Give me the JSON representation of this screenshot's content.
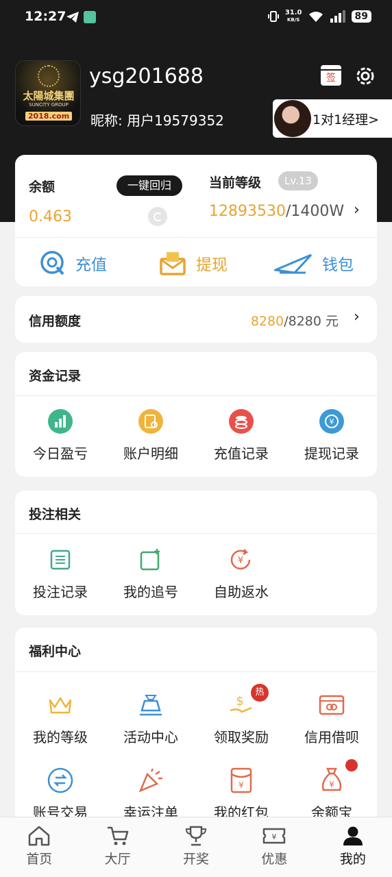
{
  "status_bar": {
    "time": "12:27",
    "net_speed": "31.0",
    "net_unit": "KB/S",
    "battery": "89"
  },
  "profile": {
    "logo_text": "太陽城集團",
    "logo_sub": "SUNCITY GROUP",
    "logo_domain": "2018.com",
    "username": "ysg201688",
    "nickname": "昵称: 用户19579352",
    "sign_label": "签",
    "manager_label": "1对1经理>"
  },
  "balance_card": {
    "balance_label": "余额",
    "recall_button": "一键回归",
    "balance_value": "0.463",
    "level_label": "当前等级",
    "level_badge": "Lv.13",
    "exp_current": "12893530",
    "exp_max": "/1400W",
    "actions": [
      {
        "label": "充值",
        "icon": "recharge-icon",
        "color": "#3d8fd6"
      },
      {
        "label": "提现",
        "icon": "withdraw-icon",
        "color": "#e7a431"
      },
      {
        "label": "钱包",
        "icon": "wallet-icon",
        "color": "#3d8fd6"
      }
    ]
  },
  "credit": {
    "label": "信用额度",
    "available": "8280",
    "total": "/8280 元"
  },
  "funds": {
    "title": "资金记录",
    "items": [
      {
        "label": "今日盈亏",
        "icon": "chart-icon",
        "color": "#3fb58a"
      },
      {
        "label": "账户明细",
        "icon": "detail-icon",
        "color": "#f0b43c"
      },
      {
        "label": "充值记录",
        "icon": "coins-icon",
        "color": "#e8504a"
      },
      {
        "label": "提现记录",
        "icon": "exchange-icon",
        "color": "#3d9ad6"
      }
    ]
  },
  "bets": {
    "title": "投注相关",
    "items": [
      {
        "label": "投注记录",
        "icon": "list-icon",
        "color": "#3fa88f"
      },
      {
        "label": "我的追号",
        "icon": "add-square-icon",
        "color": "#3fa870"
      },
      {
        "label": "自助返水",
        "icon": "rebate-icon",
        "color": "#e06a4a"
      }
    ]
  },
  "welfare": {
    "title": "福利中心",
    "items": [
      {
        "label": "我的等级",
        "icon": "crown-icon",
        "color": "#f0b43c"
      },
      {
        "label": "活动中心",
        "icon": "gift-icon",
        "color": "#3d8fd6"
      },
      {
        "label": "领取奖励",
        "icon": "reward-icon",
        "color": "#f0b43c",
        "badge": "热"
      },
      {
        "label": "信用借呗",
        "icon": "card-icon",
        "color": "#e06a4a"
      },
      {
        "label": "账号交易",
        "icon": "swap-icon",
        "color": "#3d8fd6"
      },
      {
        "label": "幸运注单",
        "icon": "party-icon",
        "color": "#e06a4a"
      },
      {
        "label": "我的红包",
        "icon": "red-envelope-icon",
        "color": "#e06a4a"
      },
      {
        "label": "余额宝",
        "icon": "money-bag-icon",
        "color": "#e06a4a",
        "dot": true
      }
    ]
  },
  "tabbar": [
    {
      "label": "首页",
      "icon": "home-icon"
    },
    {
      "label": "大厅",
      "icon": "cart-icon"
    },
    {
      "label": "开奖",
      "icon": "trophy-icon"
    },
    {
      "label": "优惠",
      "icon": "ticket-icon"
    },
    {
      "label": "我的",
      "icon": "user-icon",
      "active": true
    }
  ]
}
